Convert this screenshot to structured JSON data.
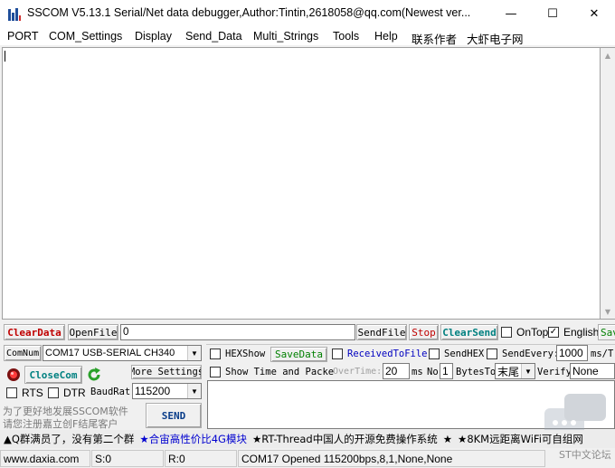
{
  "window": {
    "title": "SSCOM V5.13.1 Serial/Net data debugger,Author:Tintin,2618058@qq.com(Newest ver...",
    "min_glyph": "—",
    "max_glyph": "☐",
    "close_glyph": "✕"
  },
  "menu": [
    "PORT",
    "COM_Settings",
    "Display",
    "Send_Data",
    "Multi_Strings",
    "Tools",
    "Help",
    "联系作者",
    "大虾电子网"
  ],
  "toolbar": {
    "clear_data": "ClearData",
    "open_file": "OpenFile",
    "file_path": "0",
    "send_file": "SendFile",
    "stop": "Stop",
    "clear_send": "ClearSend",
    "on_top": "OnTop",
    "english": "English",
    "save": "Sav"
  },
  "port": {
    "comnum_label": "ComNum",
    "port_value": "COM17 USB-SERIAL CH340",
    "close_com": "CloseCom",
    "more_settings": "More Settings",
    "rts": "RTS",
    "dtr": "DTR",
    "baud_label": "BaudRat",
    "baud_value": "115200",
    "promo_line1": "为了更好地发展SSCOM软件",
    "promo_line2": "请您注册嘉立创F结尾客户",
    "send": "SEND"
  },
  "options": {
    "hex_show": "HEXShow",
    "save_data": "SaveData",
    "received_to_file": "ReceivedToFile",
    "send_hex": "SendHEX",
    "send_every": "SendEvery:",
    "interval": "1000",
    "interval_unit": "ms/T",
    "show_time": "Show Time and Packe",
    "overtime": "OverTime:",
    "overtime_value": "20",
    "ms": "ms",
    "no": "No",
    "no_value": "1",
    "bytes_to": "BytesTo",
    "ending_value": "末尾",
    "verify": "Verify",
    "verify_value": "None"
  },
  "notice": {
    "part1": "▲Q群满员了，没有第二个群",
    "part2": "★合宙高性价比4G模块",
    "part3": "★RT-Thread中国人的开源免费操作系统",
    "part4": "★",
    "part5": "★8KM远距离WiFi可自组网"
  },
  "status": {
    "site": "www.daxia.com",
    "sent": "S:0",
    "received": "R:0",
    "port_state": "COM17 Opened  115200bps,8,1,None,None"
  },
  "watermark": "ST中文论坛"
}
